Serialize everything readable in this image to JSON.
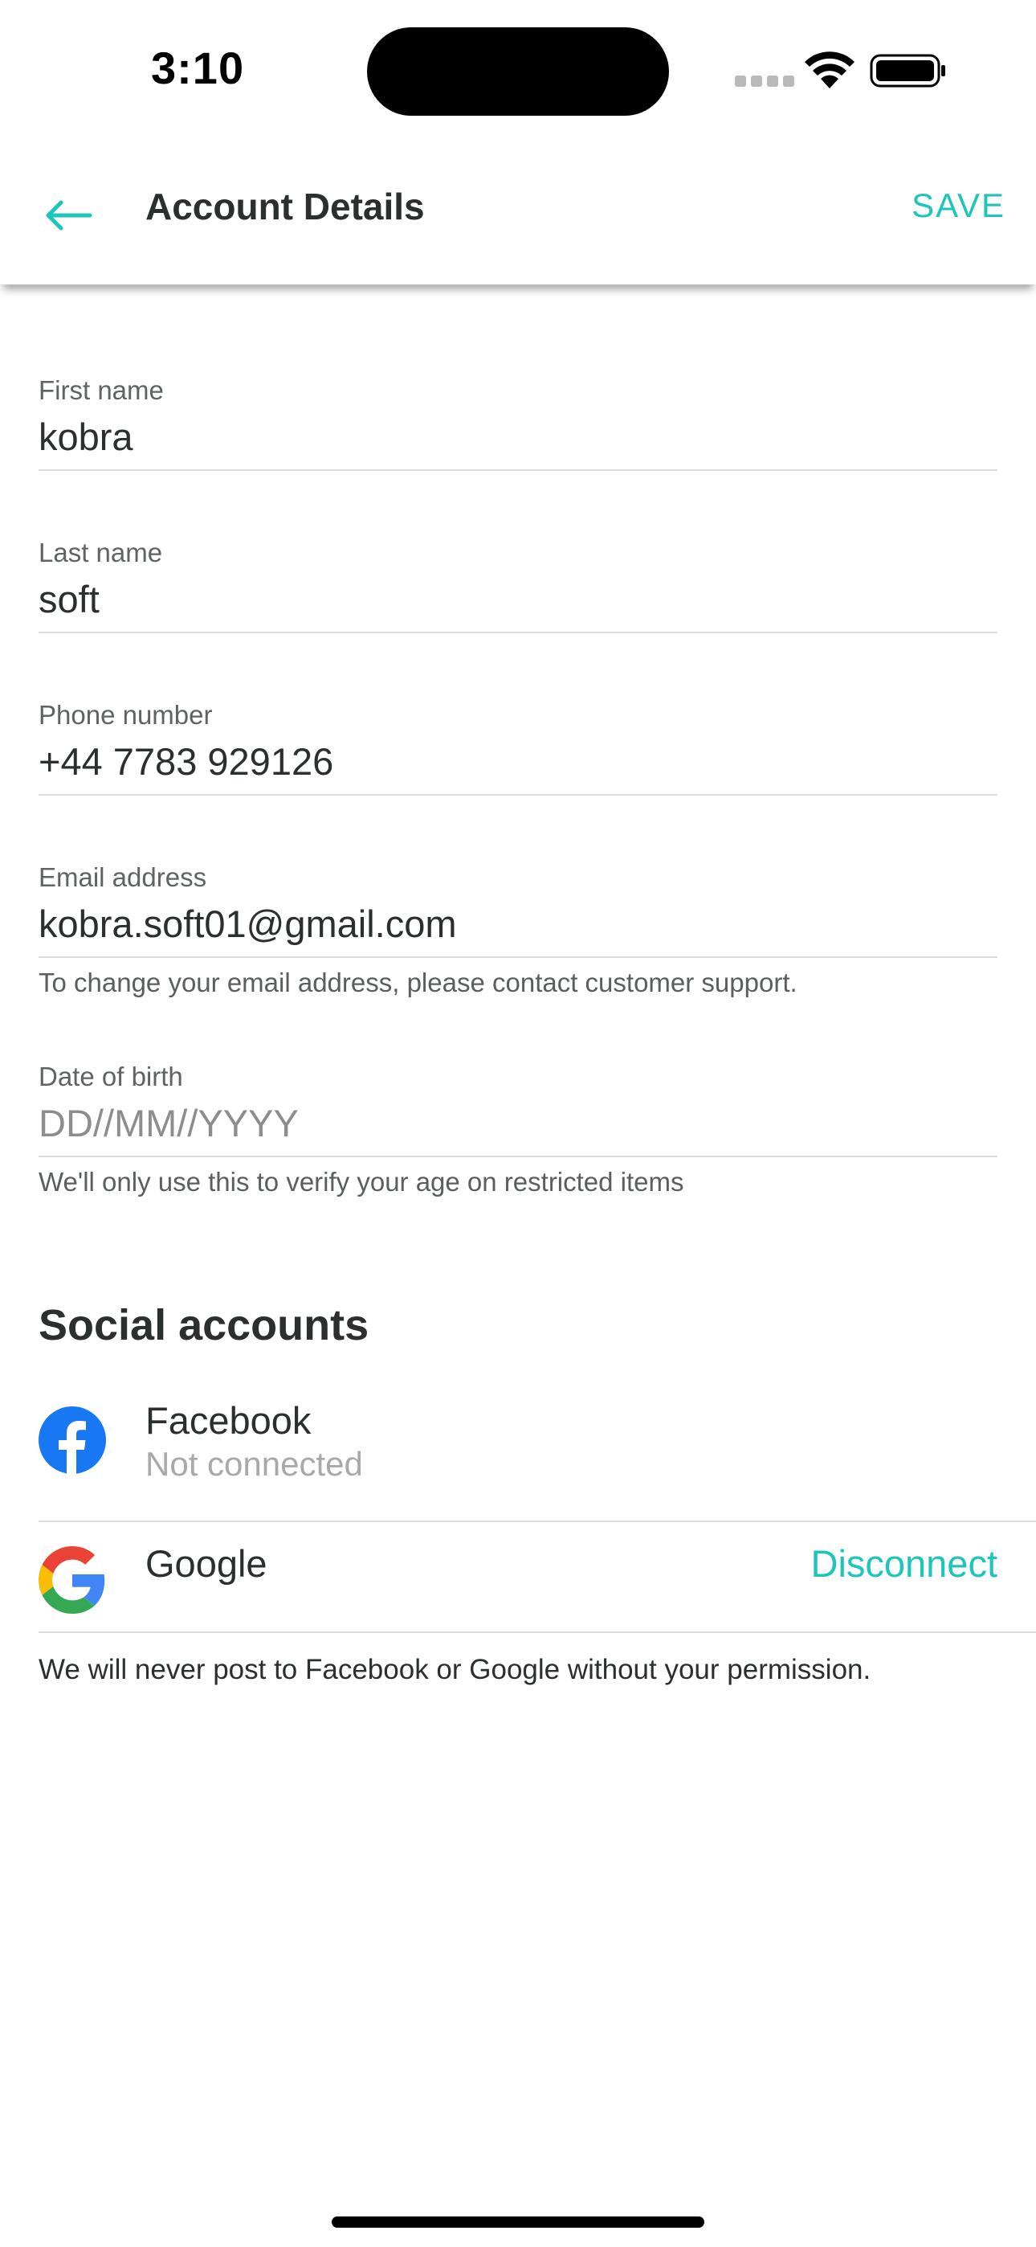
{
  "status_bar": {
    "time": "3:10"
  },
  "header": {
    "title": "Account Details",
    "save_label": "SAVE",
    "back_icon": "arrow-left-icon",
    "accent_color": "#1ec5bb"
  },
  "form": {
    "first_name": {
      "label": "First name",
      "value": "kobra"
    },
    "last_name": {
      "label": "Last name",
      "value": "soft"
    },
    "phone": {
      "label": "Phone number",
      "value": "+44 7783 929126"
    },
    "email": {
      "label": "Email address",
      "value": "kobra.soft01@gmail.com",
      "hint": "To change your email address, please contact customer support."
    },
    "dob": {
      "label": "Date of birth",
      "value": "",
      "placeholder": "DD//MM//YYYY",
      "hint": "We'll only use this to verify your age on restricted items"
    }
  },
  "social": {
    "heading": "Social accounts",
    "facebook": {
      "name": "Facebook",
      "status": "Not connected",
      "icon": "facebook-icon",
      "color": "#1877f2"
    },
    "google": {
      "name": "Google",
      "action": "Disconnect",
      "icon": "google-icon"
    },
    "note": "We will never post to Facebook or Google without your permission."
  }
}
